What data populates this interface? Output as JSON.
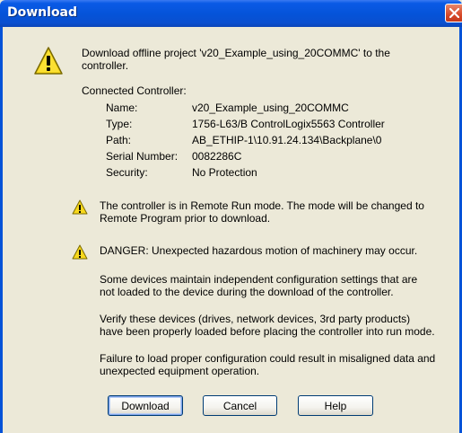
{
  "window": {
    "title": "Download"
  },
  "message": {
    "intro_line1": "Download offline project 'v20_Example_using_20COMMC' to the",
    "intro_line2": "controller.",
    "connected_heading": "Connected Controller:"
  },
  "controller": {
    "fields": [
      {
        "label": "Name:",
        "value": "v20_Example_using_20COMMC"
      },
      {
        "label": "Type:",
        "value": "1756-L63/B ControlLogix5563 Controller"
      },
      {
        "label": "Path:",
        "value": "AB_ETHIP-1\\10.91.24.134\\Backplane\\0"
      },
      {
        "label": "Serial Number:",
        "value": "0082286C"
      },
      {
        "label": "Security:",
        "value": "No Protection"
      }
    ]
  },
  "warnings": {
    "remote_run_line1": "The controller is in Remote Run mode. The mode will be changed to",
    "remote_run_line2": "Remote Program prior to download.",
    "danger": "DANGER: Unexpected hazardous motion of machinery may occur."
  },
  "notes": {
    "p1_line1": "Some devices maintain independent configuration settings that are",
    "p1_line2": "not loaded to the device during the download of the controller.",
    "p2_line1": "Verify these devices (drives, network devices, 3rd party products)",
    "p2_line2": "have been properly loaded before placing the controller into run mode.",
    "p3_line1": "Failure to load proper configuration could result in misaligned data and",
    "p3_line2": "unexpected equipment operation."
  },
  "buttons": {
    "download": "Download",
    "cancel": "Cancel",
    "help": "Help"
  },
  "colors": {
    "titlebar": "#0553d8",
    "dialog_bg": "#ece9d8",
    "close": "#d74a2a",
    "warning_yellow": "#f8d81c"
  },
  "icons": {
    "title_close": "close-icon",
    "main": "warning-icon"
  }
}
